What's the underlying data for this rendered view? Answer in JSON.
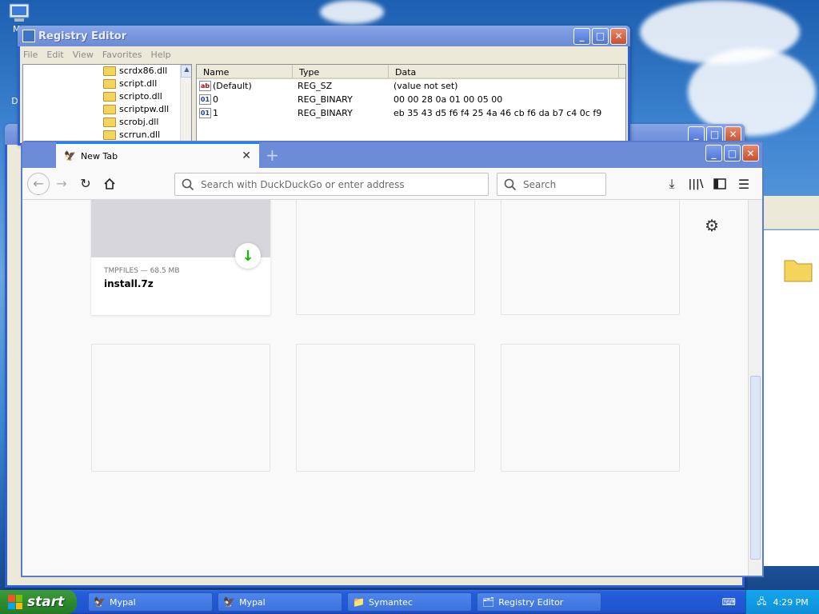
{
  "desktop": {
    "icons": [
      {
        "label": "My",
        "icon": "computer-icon"
      },
      {
        "label": "Dat",
        "icon": "document-icon"
      }
    ]
  },
  "registry": {
    "title": "Registry Editor",
    "menu": [
      "File",
      "Edit",
      "View",
      "Favorites",
      "Help"
    ],
    "tree": [
      "scrdx86.dll",
      "script.dll",
      "scripto.dll",
      "scriptpw.dll",
      "scrobj.dll",
      "scrrun.dll"
    ],
    "columns": {
      "name": "Name",
      "type": "Type",
      "data": "Data"
    },
    "rows": [
      {
        "name": "(Default)",
        "type": "REG_SZ",
        "data": "(value not set)",
        "icon": "ab"
      },
      {
        "name": "0",
        "type": "REG_BINARY",
        "data": "00 00 28 0a 01 00 05 00",
        "icon": "bin"
      },
      {
        "name": "1",
        "type": "REG_BINARY",
        "data": "eb 35 43 d5 f6 f4 25 4a 46 cb f6 da b7 c4 0c f9",
        "icon": "bin"
      }
    ]
  },
  "firefox": {
    "tab_title": "New Tab",
    "url_placeholder": "Search with DuckDuckGo or enter address",
    "search_placeholder": "Search",
    "download_tile": {
      "source": "TMPFILES — 68.5 MB",
      "name": "install.7z"
    }
  },
  "taskbar": {
    "start_label": "start",
    "tasks": [
      {
        "label": "Mypal",
        "icon": "mypal-icon"
      },
      {
        "label": "Mypal",
        "icon": "mypal-icon"
      },
      {
        "label": "Symantec",
        "icon": "folder-icon"
      },
      {
        "label": "Registry Editor",
        "icon": "registry-icon"
      }
    ],
    "clock": "4:29 PM"
  },
  "colors": {
    "xp_blue": "#245edb",
    "start_green": "#2e8a2e",
    "tab_accent": "#0a84ff",
    "download_green": "#12bc00"
  }
}
